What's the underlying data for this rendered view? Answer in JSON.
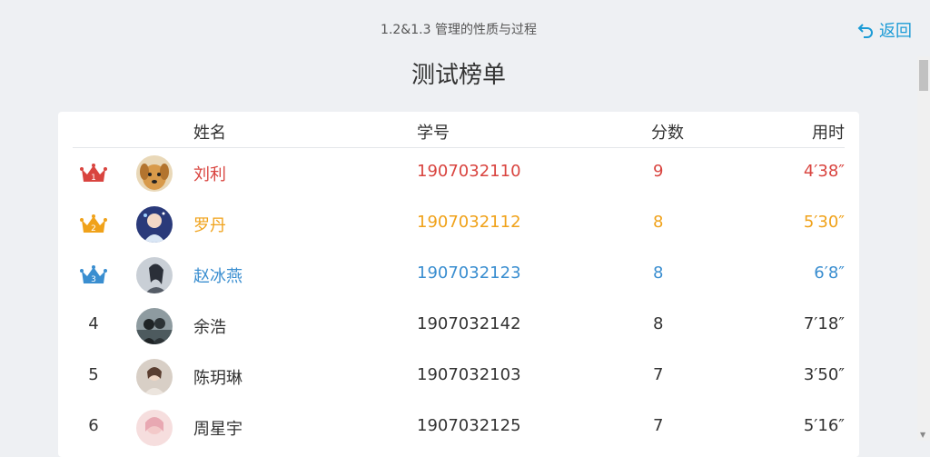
{
  "header": {
    "subtitle": "1.2&1.3 管理的性质与过程",
    "back_label": "返回",
    "title": "测试榜单"
  },
  "table": {
    "columns": {
      "name": "姓名",
      "id": "学号",
      "score": "分数",
      "time": "用时"
    },
    "rows": [
      {
        "rank": "1",
        "name": "刘利",
        "id": "1907032110",
        "score": "9",
        "time": "4′38″",
        "crown_color": "#d9443f"
      },
      {
        "rank": "2",
        "name": "罗丹",
        "id": "1907032112",
        "score": "8",
        "time": "5′30″",
        "crown_color": "#f0a21a"
      },
      {
        "rank": "3",
        "name": "赵冰燕",
        "id": "1907032123",
        "score": "8",
        "time": "6′8″",
        "crown_color": "#3a8ed0"
      },
      {
        "rank": "4",
        "name": "余浩",
        "id": "1907032142",
        "score": "8",
        "time": "7′18″"
      },
      {
        "rank": "5",
        "name": "陈玥琳",
        "id": "1907032103",
        "score": "7",
        "time": "3′50″"
      },
      {
        "rank": "6",
        "name": "周星宇",
        "id": "1907032125",
        "score": "7",
        "time": "5′16″"
      }
    ]
  },
  "colors": {
    "gold": "#f0a21a",
    "red": "#d9443f",
    "blue": "#3a8ed0",
    "accent": "#1b9bd6"
  }
}
